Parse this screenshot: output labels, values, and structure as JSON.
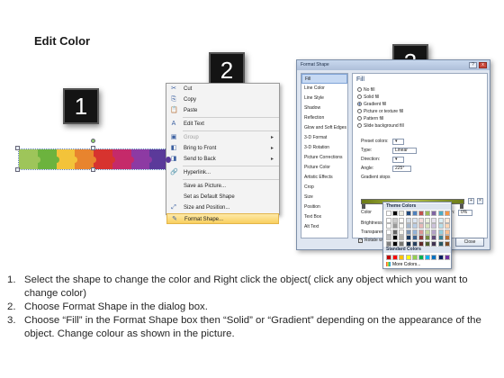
{
  "title": "Edit Color",
  "steps": [
    "1",
    "2",
    "3"
  ],
  "puzzle": {
    "colors": [
      "#9ec55a",
      "#6cb33e",
      "#f3c33a",
      "#e8842e",
      "#d7332f",
      "#c52a6a",
      "#8d3aa3",
      "#5b3a9a"
    ]
  },
  "context_menu": {
    "items": [
      {
        "label": "Cut",
        "icon": "scissors-icon",
        "glyph": "✂",
        "disabled": false
      },
      {
        "label": "Copy",
        "icon": "copy-icon",
        "glyph": "⎘",
        "disabled": false
      },
      {
        "label": "Paste",
        "icon": "paste-icon",
        "glyph": "📋",
        "disabled": false
      },
      {
        "label": "Edit Text",
        "icon": "edit-text-icon",
        "glyph": "A",
        "disabled": false
      },
      {
        "label": "Group",
        "icon": "group-icon",
        "glyph": "▣",
        "disabled": true,
        "submenu": true
      },
      {
        "label": "Bring to Front",
        "icon": "bring-to-front-icon",
        "glyph": "◧",
        "disabled": false,
        "submenu": true
      },
      {
        "label": "Send to Back",
        "icon": "send-to-back-icon",
        "glyph": "◨",
        "disabled": false,
        "submenu": true
      },
      {
        "label": "Hyperlink...",
        "icon": "hyperlink-icon",
        "glyph": "🔗",
        "disabled": false
      },
      {
        "label": "Save as Picture...",
        "icon": "",
        "glyph": "",
        "disabled": false
      },
      {
        "label": "Set as Default Shape",
        "icon": "",
        "glyph": "",
        "disabled": false
      },
      {
        "label": "Size and Position...",
        "icon": "size-position-icon",
        "glyph": "⤢",
        "disabled": false
      },
      {
        "label": "Format Shape...",
        "icon": "format-shape-icon",
        "glyph": "✎",
        "disabled": false,
        "highlighted": true
      }
    ]
  },
  "dialog": {
    "title": "Format Shape",
    "window_buttons": {
      "help": "?",
      "close": "x"
    },
    "nav": [
      "Fill",
      "Line Color",
      "Line Style",
      "Shadow",
      "Reflection",
      "Glow and Soft Edges",
      "3-D Format",
      "3-D Rotation",
      "Picture Corrections",
      "Picture Color",
      "Artistic Effects",
      "Crop",
      "Size",
      "Position",
      "Text Box",
      "Alt Text"
    ],
    "nav_selected": 0,
    "pane_heading": "Fill",
    "fill_options": [
      {
        "label": "No fill",
        "checked": false
      },
      {
        "label": "Solid fill",
        "checked": false
      },
      {
        "label": "Gradient fill",
        "checked": true
      },
      {
        "label": "Picture or texture fill",
        "checked": false
      },
      {
        "label": "Pattern fill",
        "checked": false
      },
      {
        "label": "Slide background fill",
        "checked": false
      }
    ],
    "preset_colors_label": "Preset colors:",
    "type_label": "Type:",
    "type_value": "Linear",
    "direction_label": "Direction:",
    "angle_label": "Angle:",
    "angle_value": "225°",
    "gradient_stops_label": "Gradient stops",
    "color_label": "Color",
    "position_label": "Position:",
    "position_value": "0%",
    "brightness_label": "Brightness:",
    "transparency_label": "Transparency:",
    "rotate_label": "Rotate with shape",
    "close_label": "Close"
  },
  "color_popup": {
    "theme_label": "Theme Colors",
    "standard_label": "Standard Colors",
    "more_label": "More Colors...",
    "theme_top": [
      "#ffffff",
      "#000000",
      "#eeece1",
      "#1f497d",
      "#4f81bd",
      "#c0504d",
      "#9bbb59",
      "#8064a2",
      "#4bacc6",
      "#f79646"
    ],
    "standard": [
      "#c00000",
      "#ff0000",
      "#ffc000",
      "#ffff00",
      "#92d050",
      "#00b050",
      "#00b0f0",
      "#0070c0",
      "#002060",
      "#7030a0"
    ]
  },
  "instructions": [
    {
      "num": "1.",
      "text": "Select the shape to change the color and Right click the object( click any object which you want to change color)"
    },
    {
      "num": "2.",
      "text": "Choose Format Shape in the dialog box."
    },
    {
      "num": "3.",
      "text": "Choose “Fill” in the Format Shape box then “Solid” or “Gradient” depending on the appearance of the object. Change colour as shown in the picture."
    }
  ]
}
